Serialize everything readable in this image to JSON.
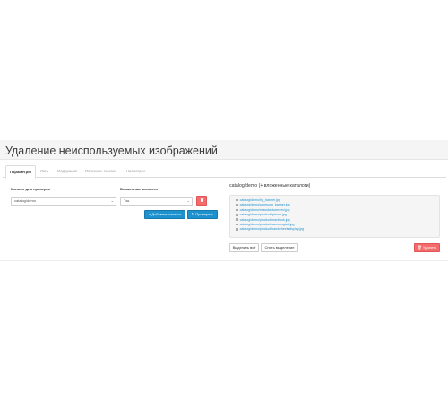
{
  "page": {
    "title": "Удаление неиспользуемых изображений"
  },
  "tabs": [
    {
      "label": "Параметры",
      "active": true
    },
    {
      "label": "Лога",
      "active": false
    },
    {
      "label": "Модерация",
      "active": false
    },
    {
      "label": "Полезные ссылки",
      "active": false
    },
    {
      "label": "Насмотрее",
      "active": false
    }
  ],
  "form": {
    "catalog_label": "Каталог для проверки",
    "catalog_value": "catalog/demo",
    "nested_label": "Вложенные каталоги",
    "nested_value": "Так",
    "add_catalog_label": "Добавить каталог",
    "check_label": "Проверить",
    "delete_icon": "trash-icon"
  },
  "results": {
    "title": "catalog/demo (+ вложенные каталоги)",
    "files": [
      "catalog/demo/hp_banner.jpg",
      "catalog/demo/samsung_banner.jpg",
      "catalog/demo/manufacturer/red.jpg",
      "catalog/demo/product/iphone.jpg",
      "catalog/demo/product/macbook.jpg",
      "catalog/demo/product/samsungtab.jpg",
      "catalog/demo/product/handwheelsdisplay.jpg"
    ],
    "select_all_label": "Выделить всё",
    "clear_selection_label": "Снять выделение",
    "delete_label": "Удалить"
  },
  "colors": {
    "primary": "#1e91cf",
    "danger": "#f56b6b",
    "header_bg": "#f5f5f5"
  }
}
